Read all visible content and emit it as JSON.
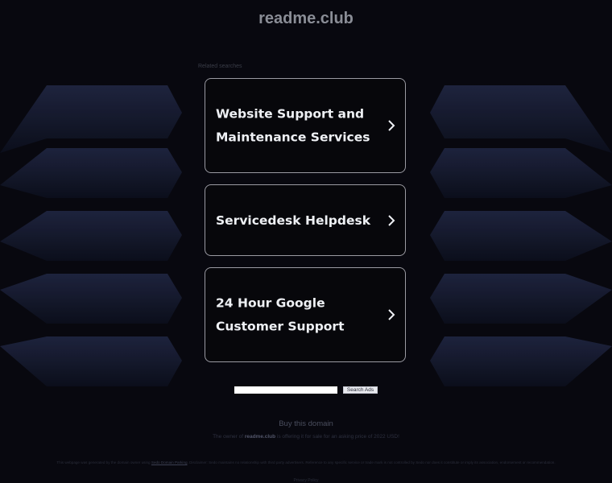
{
  "header": {
    "domain": "readme.club"
  },
  "related": {
    "label": "Related searches",
    "items": [
      {
        "label": "Website Support and Maintenance Services"
      },
      {
        "label": "Servicedesk Helpdesk"
      },
      {
        "label": "24 Hour Google Customer Support"
      }
    ]
  },
  "search": {
    "value": "",
    "button_label": "Search Ads"
  },
  "sale": {
    "buy_label": "Buy this domain",
    "prefix": "The owner of",
    "domain": "readme.club",
    "suffix": "is offering it for sale for an asking price of 2022 USD!"
  },
  "footer": {
    "disclaimer_prefix": "This webpage was generated by the domain owner using",
    "disclaimer_link": "Sedo Domain Parking",
    "disclaimer_suffix": ". Disclaimer: Sedo maintains no relationship with third party advertisers. Reference to any specific service or trade mark is not controlled by Sedo nor does it constitute or imply its association, endorsement or recommendation.",
    "privacy_label": "Privacy Policy"
  },
  "colors": {
    "background": "#08080f",
    "card_border": "#9a9aa2",
    "card_text": "#eef0f4",
    "decor": "#1c2238"
  },
  "icons": {
    "card_arrow": "chevron-right-icon"
  }
}
